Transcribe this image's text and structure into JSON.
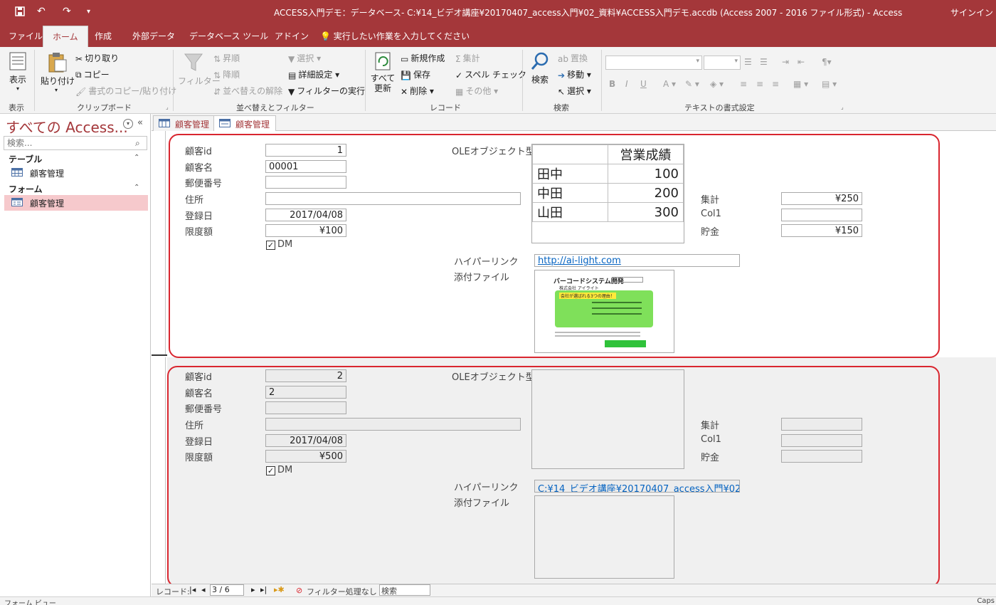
{
  "titlebar": {
    "title": "ACCESS入門デモ：データベース- C:¥14_ビデオ講座¥20170407_access入門¥02_資料¥ACCESS入門デモ.accdb (Access 2007 - 2016 ファイル形式)  -  Access",
    "signin": "サインイン"
  },
  "ribbon_tabs": {
    "file": "ファイル",
    "home": "ホーム",
    "create": "作成",
    "external": "外部データ",
    "dbtools": "データベース ツール",
    "addin": "アドイン",
    "tellme": "実行したい作業を入力してください"
  },
  "ribbon": {
    "view": "表示",
    "view_group": "表示",
    "paste": "貼り付け",
    "cut": "切り取り",
    "copy": "コピー",
    "format_painter": "書式のコピー/貼り付け",
    "clipboard_group": "クリップボード",
    "filter": "フィルター",
    "ascending": "昇順",
    "descending": "降順",
    "remove_sort": "並べ替えの解除",
    "selection": "選択",
    "advanced": "詳細設定",
    "toggle_filter": "フィルターの実行",
    "sort_group": "並べ替えとフィルター",
    "refresh_all_1": "すべて",
    "refresh_all_2": "更新",
    "new": "新規作成",
    "save": "保存",
    "delete": "削除",
    "totals": "集計",
    "spelling": "スペル チェック",
    "more": "その他",
    "records_group": "レコード",
    "find": "検索",
    "replace": "置換",
    "goto": "移動",
    "select": "選択",
    "find_group": "検索",
    "text_group": "テキストの書式設定"
  },
  "nav": {
    "header": "すべての Access...",
    "search_placeholder": "検索...",
    "group_tables": "テーブル",
    "table_item": "顧客管理",
    "group_forms": "フォーム",
    "form_item": "顧客管理"
  },
  "doc_tabs": [
    "顧客管理",
    "顧客管理"
  ],
  "labels": {
    "id": "顧客id",
    "name": "顧客名",
    "zip": "郵便番号",
    "address": "住所",
    "regdate": "登録日",
    "limit": "限度額",
    "dm": "DM",
    "ole": "OLEオブジェクト型",
    "total": "集計",
    "col1": "Col1",
    "savings": "貯金",
    "hyperlink": "ハイパーリンク",
    "attachment": "添付ファイル"
  },
  "records": [
    {
      "id": "1",
      "name": "00001",
      "zip": "",
      "address": "",
      "regdate": "2017/04/08",
      "limit": "¥100",
      "dm": true,
      "total": "¥250",
      "col1": "",
      "savings": "¥150",
      "hyperlink": "http://ai-light.com",
      "ole_table": {
        "header": "営業成績",
        "rows": [
          [
            "田中",
            "100"
          ],
          [
            "中田",
            "200"
          ],
          [
            "山田",
            "300"
          ]
        ]
      },
      "attachment_preview": {
        "title": "バーコードシステム開発",
        "company": "株式会社 アイライト",
        "badge": "会社が選ばれる3つの理由！"
      }
    },
    {
      "id": "2",
      "name": "2",
      "zip": "",
      "address": "",
      "regdate": "2017/04/08",
      "limit": "¥500",
      "dm": true,
      "total": "",
      "col1": "",
      "savings": "",
      "hyperlink": "C:¥14_ビデオ講座¥20170407_access入門¥02"
    }
  ],
  "recnav": {
    "label": "レコード:",
    "position": "3 / 6",
    "filter": "フィルター処理なし",
    "search": "検索"
  },
  "statusbar": {
    "left": "フォーム ビュー",
    "right": "Caps"
  },
  "colors": {
    "accent": "#a4373a",
    "highlight_box": "#d9262f",
    "nav_selected": "#f6c9cc"
  }
}
